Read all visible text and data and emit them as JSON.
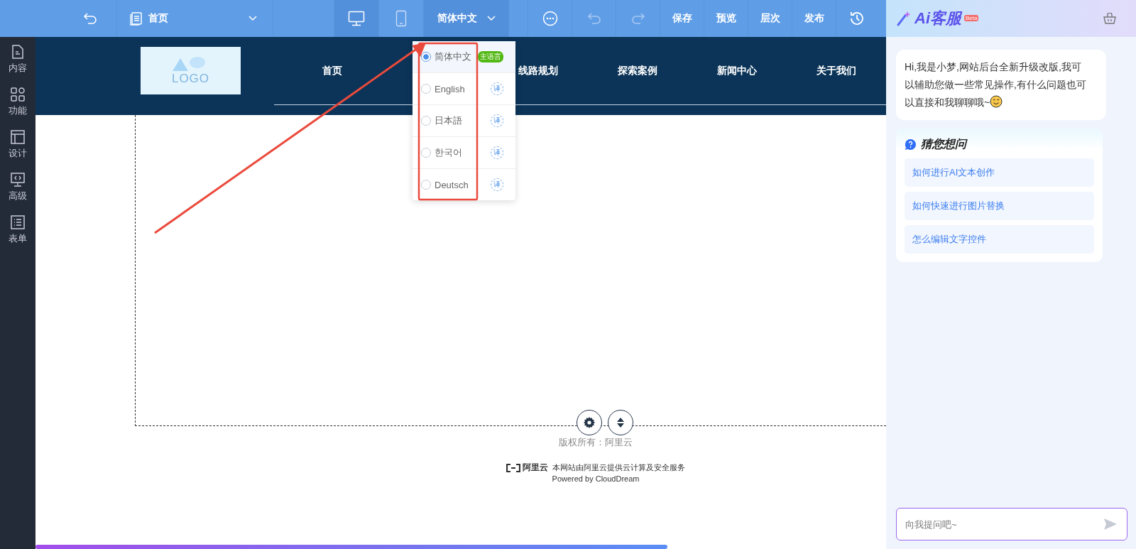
{
  "toolbar": {
    "page_selector": "首页",
    "devices": [
      {
        "kind": "desktop",
        "selected": true
      },
      {
        "kind": "mobile",
        "selected": false
      }
    ],
    "language": "简体中文",
    "actions": [
      "保存",
      "预览",
      "层次",
      "发布"
    ]
  },
  "sidebar": {
    "items": [
      {
        "kind": "content",
        "label": "内容"
      },
      {
        "kind": "apps",
        "label": "功能"
      },
      {
        "kind": "layout",
        "label": "设计"
      },
      {
        "kind": "code",
        "label": "高级"
      },
      {
        "kind": "form",
        "label": "表单"
      }
    ]
  },
  "language_menu": {
    "items": [
      {
        "label": "简体中文",
        "selected": true,
        "badge": "主语言"
      },
      {
        "label": "English",
        "selected": false,
        "translate": "译"
      },
      {
        "label": "日本語",
        "selected": false,
        "translate": "译"
      },
      {
        "label": "한국어",
        "selected": false,
        "translate": "译"
      },
      {
        "label": "Deutsch",
        "selected": false,
        "translate": "译"
      }
    ]
  },
  "site": {
    "logo": "LOGO",
    "nav": [
      "首页",
      "线路规划",
      "探索案例",
      "新闻中心",
      "关于我们"
    ],
    "copyright": "版权所有：阿里云",
    "provider_logo": "阿里云",
    "provider_text": "本网站由阿里云提供云计算及安全服务",
    "powered_by": "Powered by CloudDream"
  },
  "assistant": {
    "title": "Ai客服",
    "badge": "Beta",
    "greeting": "Hi,我是小梦,网站后台全新升级改版,我可以辅助您做一些常见操作,有什么问题也可以直接和我聊聊哦~",
    "suggestions_title": "猜您想问",
    "suggestions": [
      "如何进行AI文本创作",
      "如何快速进行图片替换",
      "怎么编辑文字控件"
    ],
    "input_placeholder": "向我提问吧~"
  }
}
